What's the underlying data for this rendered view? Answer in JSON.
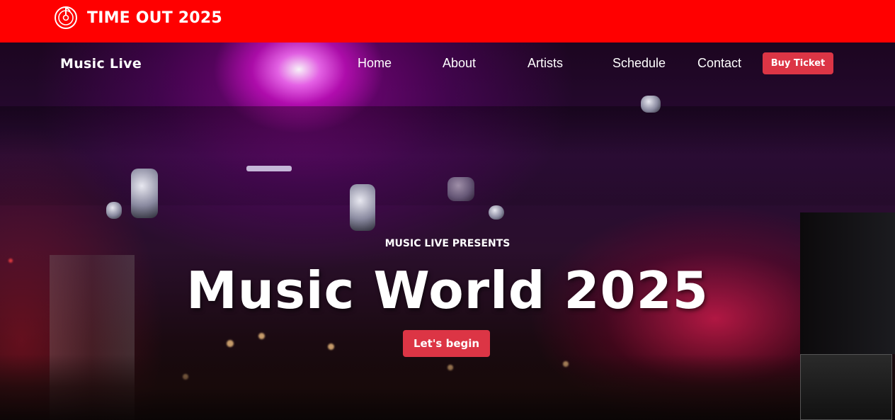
{
  "topbar": {
    "logo_icon": "music-disc-icon",
    "title": "TIME OUT 2025",
    "background_color": "#ff0000"
  },
  "navbar": {
    "brand": "Music Live",
    "links": [
      "Home",
      "About",
      "Artists",
      "Schedule",
      "Contact"
    ],
    "buy_ticket_label": "Buy Ticket",
    "button_color": "#dc3545"
  },
  "hero": {
    "presents": "MUSIC LIVE PRESENTS",
    "title": "Music World 2025",
    "cta_label": "Let's begin"
  }
}
